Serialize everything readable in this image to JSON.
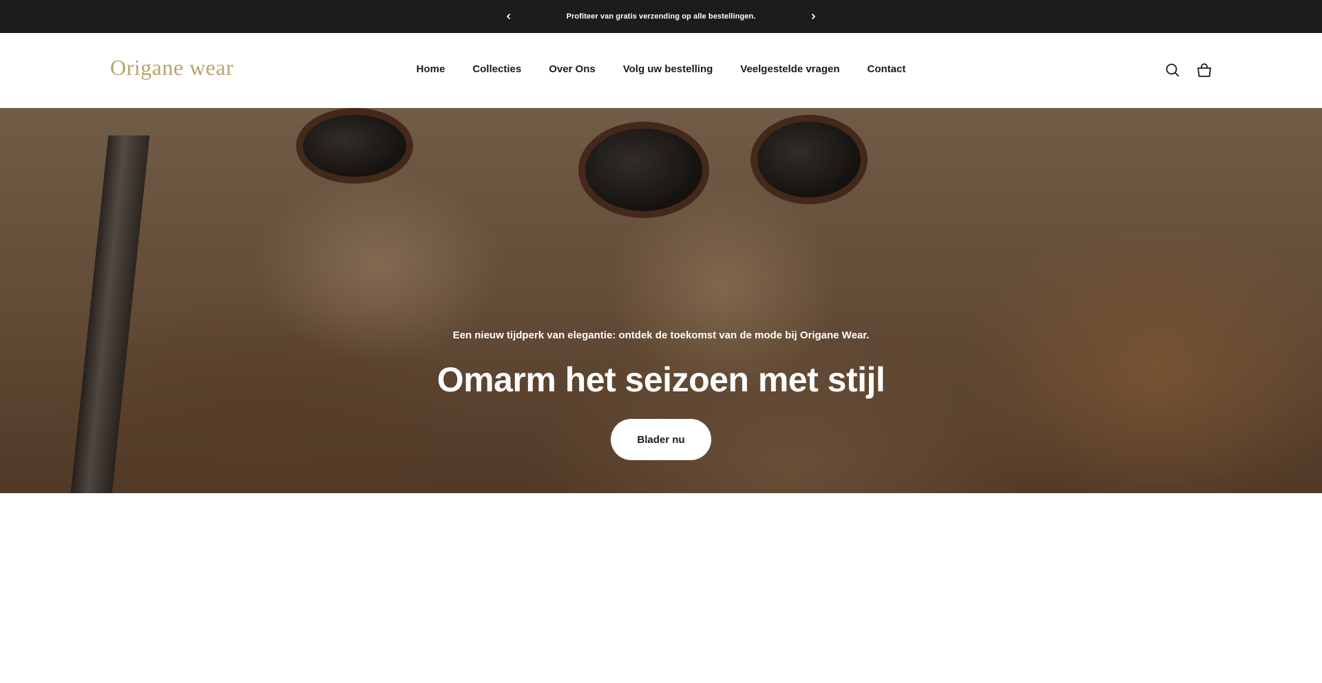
{
  "announcement": {
    "message": "Profiteer van gratis verzending op alle bestellingen.",
    "prev_icon": "chevron-left-icon",
    "next_icon": "chevron-right-icon"
  },
  "header": {
    "logo": "Origane wear",
    "nav": [
      "Home",
      "Collecties",
      "Over Ons",
      "Volg uw bestelling",
      "Veelgestelde vragen",
      "Contact"
    ],
    "icons": [
      "search-icon",
      "shopping-bag-icon"
    ]
  },
  "hero": {
    "subheading": "Een nieuw tijdperk van elegantie: ontdek de toekomst van de mode bij Origane Wear.",
    "heading": "Omarm het seizoen met stijl",
    "cta_label": "Blader nu"
  },
  "colors": {
    "announcement_bg": "#1c1c1c",
    "logo": "#b8a46f",
    "button_bg": "#ffffff"
  }
}
